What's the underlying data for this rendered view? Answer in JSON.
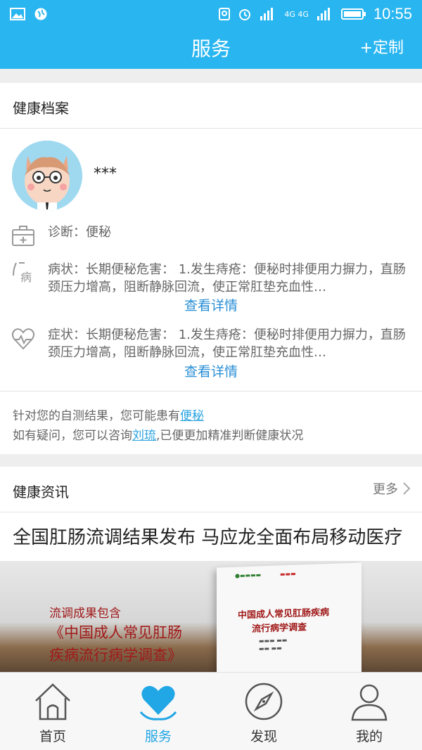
{
  "status_bar": {
    "time": "10:55",
    "network": "4G 4G"
  },
  "header": {
    "title": "服务",
    "action": "+定制"
  },
  "health_record": {
    "title": "健康档案",
    "username": "***",
    "diagnosis": "诊断：便秘",
    "disease": "病状：长期便秘危害：        1.发生痔疮：便秘时排便用力摒力，直肠颈压力增高，阻断静脉回流，使正常肛垫充血性…",
    "symptom": "症状：长期便秘危害：        1.发生痔疮：便秘时排便用力摒力，直肠颈压力增高，阻断静脉回流，使正常肛垫充血性…",
    "detail_link": "查看详情",
    "hint": {
      "line1_prefix": "针对您的自测结果，您可能患有",
      "line1_link": "便秘",
      "line2_prefix": "如有疑问，您可以咨询",
      "line2_link": "刘琉",
      "line2_suffix": ",已便更加精准判断健康状况"
    }
  },
  "news": {
    "title": "健康资讯",
    "more": "更多",
    "headline": "全国肛肠流调结果发布 马应龙全面布局移动医疗",
    "banner": {
      "line1": "流调成果包含",
      "line2": "《中国成人常见肛肠",
      "line3": "疾病流行病学调查》",
      "book_title1": "中国成人常见肛肠疾病",
      "book_title2": "流行病学调查"
    }
  },
  "tabs": [
    {
      "label": "首页",
      "icon": "home-icon",
      "active": false
    },
    {
      "label": "服务",
      "icon": "heart-icon",
      "active": true
    },
    {
      "label": "发现",
      "icon": "compass-icon",
      "active": false
    },
    {
      "label": "我的",
      "icon": "user-icon",
      "active": false
    }
  ],
  "colors": {
    "primary": "#29b6f0",
    "link": "#2a8fd6",
    "active_tab": "#21a6e6",
    "banner_red": "#a01919"
  }
}
